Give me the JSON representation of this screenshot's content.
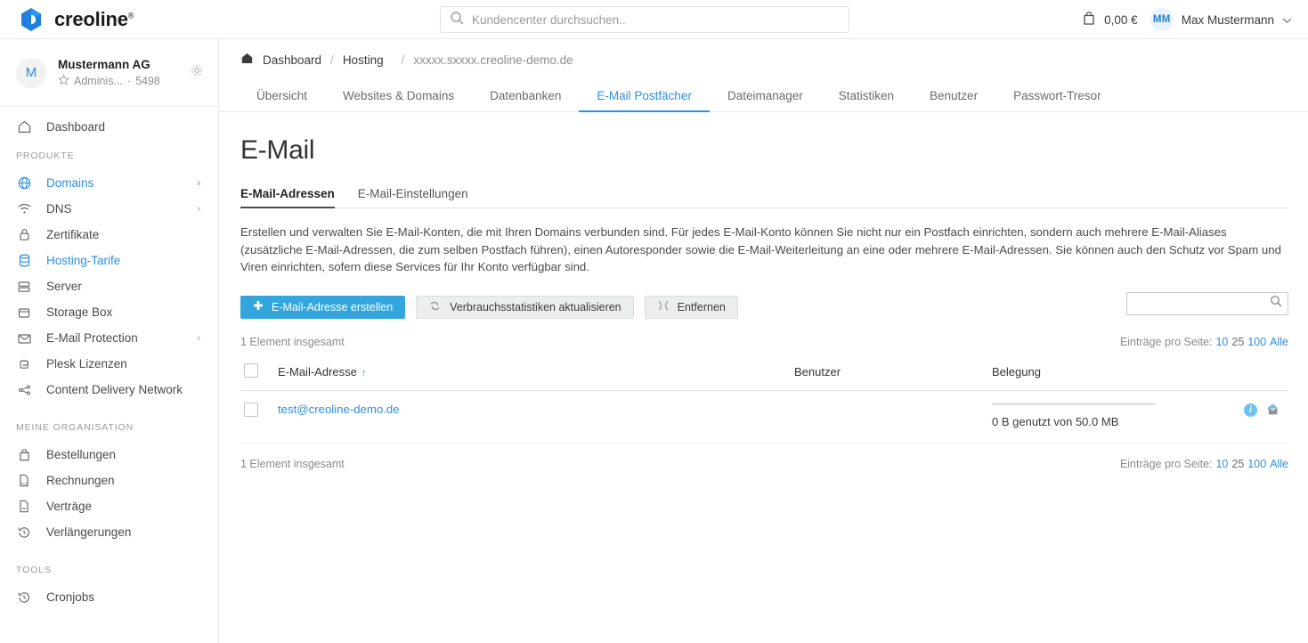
{
  "topbar": {
    "brand_name": "creoline",
    "brand_mark": "creoline-logo",
    "search_placeholder": "Kundencenter durchsuchen..",
    "search_value": "",
    "cart_amount": "0,00 €",
    "user_initials": "MM",
    "user_name": "Max Mustermann"
  },
  "org": {
    "initial": "M",
    "name": "Mustermann AG",
    "role": "Adminis...",
    "separator": "·",
    "id": "5498"
  },
  "sidebar": {
    "dashboard": "Dashboard",
    "sections": [
      {
        "title": "PRODUKTE",
        "items": [
          {
            "label": "Domains",
            "icon": "globe-icon",
            "active": true,
            "chevron": true
          },
          {
            "label": "DNS",
            "icon": "wifi-icon",
            "active": false,
            "chevron": true
          },
          {
            "label": "Zertifikate",
            "icon": "lock-icon",
            "active": false,
            "chevron": false
          },
          {
            "label": "Hosting-Tarife",
            "icon": "database-icon",
            "active": true,
            "chevron": false
          },
          {
            "label": "Server",
            "icon": "server-icon",
            "active": false,
            "chevron": false
          },
          {
            "label": "Storage Box",
            "icon": "box-icon",
            "active": false,
            "chevron": false
          },
          {
            "label": "E-Mail Protection",
            "icon": "envelope-icon",
            "active": false,
            "chevron": true
          },
          {
            "label": "Plesk Lizenzen",
            "icon": "plesk-icon",
            "active": false,
            "chevron": false
          },
          {
            "label": "Content Delivery Network",
            "icon": "network-icon",
            "active": false,
            "chevron": false
          }
        ]
      },
      {
        "title": "MEINE ORGANISATION",
        "items": [
          {
            "label": "Bestellungen",
            "icon": "bag-icon",
            "active": false,
            "chevron": false
          },
          {
            "label": "Rechnungen",
            "icon": "pdf-document-icon",
            "active": false,
            "chevron": false
          },
          {
            "label": "Verträge",
            "icon": "contract-document-icon",
            "active": false,
            "chevron": false
          },
          {
            "label": "Verlängerungen",
            "icon": "history-icon",
            "active": false,
            "chevron": false
          }
        ]
      },
      {
        "title": "TOOLS",
        "items": [
          {
            "label": "Cronjobs",
            "icon": "history-icon",
            "active": false,
            "chevron": false
          }
        ]
      }
    ]
  },
  "breadcrumb": {
    "home_icon": "home-icon",
    "items": [
      "Dashboard",
      "Hosting"
    ],
    "separator": "/",
    "current": "xxxxx.sxxxx.creoline-demo.de"
  },
  "subnav": {
    "items": [
      {
        "label": "Übersicht",
        "active": false
      },
      {
        "label": "Websites & Domains",
        "active": false
      },
      {
        "label": "Datenbanken",
        "active": false
      },
      {
        "label": "E-Mail Postfächer",
        "active": true
      },
      {
        "label": "Dateimanager",
        "active": false
      },
      {
        "label": "Statistiken",
        "active": false
      },
      {
        "label": "Benutzer",
        "active": false
      },
      {
        "label": "Passwort-Tresor",
        "active": false
      }
    ]
  },
  "page": {
    "title": "E-Mail",
    "tabs": [
      {
        "label": "E-Mail-Adressen",
        "active": true
      },
      {
        "label": "E-Mail-Einstellungen",
        "active": false
      }
    ],
    "description": "Erstellen und verwalten Sie E-Mail-Konten, die mit Ihren Domains verbunden sind. Für jedes E-Mail-Konto können Sie nicht nur ein Postfach einrichten, sondern auch mehrere E-Mail-Aliases (zusätzliche E-Mail-Adressen, die zum selben Postfach führen), einen Autoresponder sowie die E-Mail-Weiterleitung an eine oder mehrere E-Mail-Adressen. Sie können auch den Schutz vor Spam und Viren einrichten, sofern diese Services für Ihr Konto verfügbar sind."
  },
  "toolbar": {
    "create_label": "E-Mail-Adresse erstellen",
    "create_icon": "plus-icon",
    "refresh_label": "Verbrauchsstatistiken aktualisieren",
    "refresh_icon": "refresh-stats-icon",
    "remove_label": "Entfernen",
    "remove_icon": "remove-x-icon",
    "search_value": "",
    "search_placeholder": "",
    "search_icon": "search-icon"
  },
  "list": {
    "total_top": "1 Element insgesamt",
    "total_bottom": "1 Element insgesamt",
    "perpage_label": "Einträge pro Seite:",
    "perpage_options": [
      {
        "label": "10",
        "active": true
      },
      {
        "label": "25",
        "active": false
      },
      {
        "label": "100",
        "active": true
      },
      {
        "label": "Alle",
        "active": true
      }
    ],
    "columns": {
      "address": "E-Mail-Adresse",
      "sort_indicator": "↑",
      "user": "Benutzer",
      "usage": "Belegung"
    },
    "rows": [
      {
        "address": "test@creoline-demo.de",
        "user": "",
        "usage_text": "0 B genutzt von 50.0 MB",
        "usage_percent": 0,
        "icons": [
          "info-icon",
          "webmail-envelope-icon"
        ]
      }
    ]
  },
  "colors": {
    "accent": "#2d8fe0",
    "button_primary": "#33a6dd",
    "link": "#2d8fe0",
    "icon_blue": "#6dc2ef"
  }
}
